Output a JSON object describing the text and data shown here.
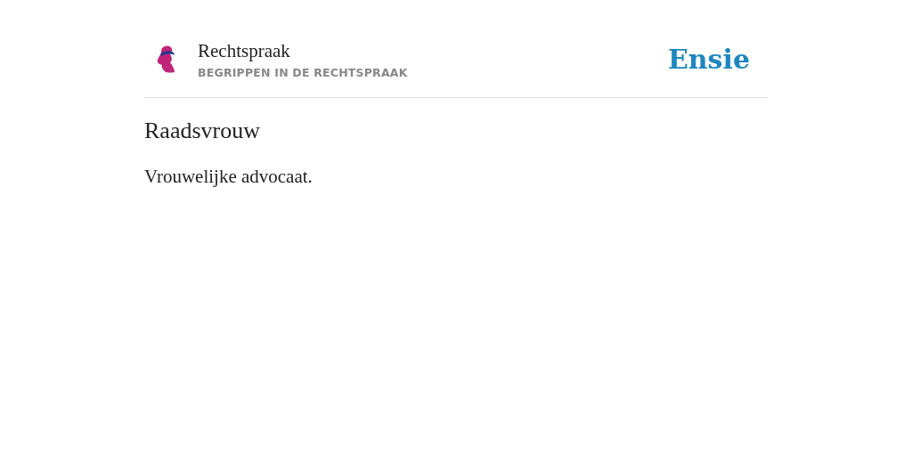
{
  "header": {
    "title": "Rechtspraak",
    "subtitle": "BEGRIPPEN IN DE RECHTSPRAAK",
    "brand": "Ensie"
  },
  "entry": {
    "term": "Raadsvrouw",
    "definition": "Vrouwelijke advocaat."
  }
}
